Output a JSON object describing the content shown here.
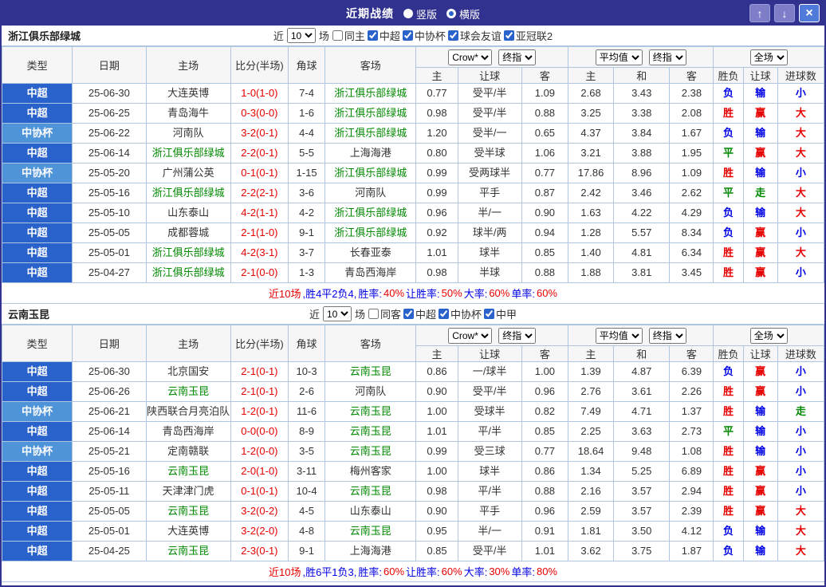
{
  "colors": {
    "accent": "#31318f",
    "grid_border": "#aec6e0",
    "league_bg": {
      "中超": "#2a62cc",
      "中协杯": "#4f94d9"
    },
    "result_text": {
      "胜": "#e60000",
      "平": "#008800",
      "负": "#0000e6",
      "赢": "#e60000",
      "走": "#008800",
      "输": "#0000e6",
      "大": "#e60000",
      "小": "#0000e6"
    },
    "score_color": "#e60000",
    "focus_team_color": "#008800"
  },
  "titlebar": {
    "title": "近期战绩",
    "layout_options": [
      {
        "label": "竖版",
        "checked": false
      },
      {
        "label": "横版",
        "checked": true
      }
    ],
    "buttons": [
      {
        "name": "move-up",
        "glyph": "↑"
      },
      {
        "name": "move-down",
        "glyph": "↓"
      },
      {
        "name": "close",
        "glyph": "×"
      }
    ]
  },
  "table_header": {
    "main_cols": [
      "类型",
      "日期",
      "主场",
      "比分(半场)",
      "角球",
      "客场"
    ],
    "asia_group": {
      "select1": "Crow*",
      "select2": "终指",
      "subcols": [
        "主",
        "让球",
        "客"
      ]
    },
    "europe_group": {
      "select1": "平均值",
      "select2": "终指",
      "subcols": [
        "主",
        "和",
        "客"
      ]
    },
    "result_group": {
      "select": "全场",
      "subcols": [
        "胜负",
        "让球",
        "进球数"
      ]
    }
  },
  "sections": [
    {
      "team": "浙江俱乐部绿城",
      "filter": {
        "near_label": "近",
        "count": "10",
        "match_label": "场",
        "checkboxes": [
          {
            "label": "同主",
            "checked": false
          },
          {
            "label": "中超",
            "checked": true
          },
          {
            "label": "中协杯",
            "checked": true
          },
          {
            "label": "球会友谊",
            "checked": true
          },
          {
            "label": "亚冠联2",
            "checked": true
          }
        ]
      },
      "rows": [
        [
          "中超",
          "25-06-30",
          "大连英博",
          "1-0(1-0)",
          "7-4",
          "浙江俱乐部绿城",
          "0.77",
          "受平/半",
          "1.09",
          "2.68",
          "3.43",
          "2.38",
          "负",
          "输",
          "小"
        ],
        [
          "中超",
          "25-06-25",
          "青岛海牛",
          "0-3(0-0)",
          "1-6",
          "浙江俱乐部绿城",
          "0.98",
          "受平/半",
          "0.88",
          "3.25",
          "3.38",
          "2.08",
          "胜",
          "赢",
          "大"
        ],
        [
          "中协杯",
          "25-06-22",
          "河南队",
          "3-2(0-1)",
          "4-4",
          "浙江俱乐部绿城",
          "1.20",
          "受半/一",
          "0.65",
          "4.37",
          "3.84",
          "1.67",
          "负",
          "输",
          "大"
        ],
        [
          "中超",
          "25-06-14",
          "浙江俱乐部绿城",
          "2-2(0-1)",
          "5-5",
          "上海海港",
          "0.80",
          "受半球",
          "1.06",
          "3.21",
          "3.88",
          "1.95",
          "平",
          "赢",
          "大"
        ],
        [
          "中协杯",
          "25-05-20",
          "广州蒲公英",
          "0-1(0-1)",
          "1-15",
          "浙江俱乐部绿城",
          "0.99",
          "受两球半",
          "0.77",
          "17.86",
          "8.96",
          "1.09",
          "胜",
          "输",
          "小"
        ],
        [
          "中超",
          "25-05-16",
          "浙江俱乐部绿城",
          "2-2(2-1)",
          "3-6",
          "河南队",
          "0.99",
          "平手",
          "0.87",
          "2.42",
          "3.46",
          "2.62",
          "平",
          "走",
          "大"
        ],
        [
          "中超",
          "25-05-10",
          "山东泰山",
          "4-2(1-1)",
          "4-2",
          "浙江俱乐部绿城",
          "0.96",
          "半/一",
          "0.90",
          "1.63",
          "4.22",
          "4.29",
          "负",
          "输",
          "大"
        ],
        [
          "中超",
          "25-05-05",
          "成都蓉城",
          "2-1(1-0)",
          "9-1",
          "浙江俱乐部绿城",
          "0.92",
          "球半/两",
          "0.94",
          "1.28",
          "5.57",
          "8.34",
          "负",
          "赢",
          "小"
        ],
        [
          "中超",
          "25-05-01",
          "浙江俱乐部绿城",
          "4-2(3-1)",
          "3-7",
          "长春亚泰",
          "1.01",
          "球半",
          "0.85",
          "1.40",
          "4.81",
          "6.34",
          "胜",
          "赢",
          "大"
        ],
        [
          "中超",
          "25-04-27",
          "浙江俱乐部绿城",
          "2-1(0-0)",
          "1-3",
          "青岛西海岸",
          "0.98",
          "半球",
          "0.88",
          "1.88",
          "3.81",
          "3.45",
          "胜",
          "赢",
          "小"
        ]
      ],
      "summary": [
        {
          "text": "近10场",
          "color": "#e60000"
        },
        {
          "text": ",胜4平2负4, ",
          "color": "#0000e6"
        },
        {
          "text": "胜率:",
          "color": "#0000e6"
        },
        {
          "text": "40%",
          "color": "#e60000"
        },
        {
          "text": " 让胜率:",
          "color": "#0000e6"
        },
        {
          "text": "50%",
          "color": "#e60000"
        },
        {
          "text": " 大率:",
          "color": "#0000e6"
        },
        {
          "text": "60%",
          "color": "#e60000"
        },
        {
          "text": " 单率:",
          "color": "#0000e6"
        },
        {
          "text": "60%",
          "color": "#e60000"
        }
      ]
    },
    {
      "team": "云南玉昆",
      "filter": {
        "near_label": "近",
        "count": "10",
        "match_label": "场",
        "checkboxes": [
          {
            "label": "同客",
            "checked": false
          },
          {
            "label": "中超",
            "checked": true
          },
          {
            "label": "中协杯",
            "checked": true
          },
          {
            "label": "中甲",
            "checked": true
          }
        ]
      },
      "rows": [
        [
          "中超",
          "25-06-30",
          "北京国安",
          "2-1(0-1)",
          "10-3",
          "云南玉昆",
          "0.86",
          "一/球半",
          "1.00",
          "1.39",
          "4.87",
          "6.39",
          "负",
          "赢",
          "小"
        ],
        [
          "中超",
          "25-06-26",
          "云南玉昆",
          "2-1(0-1)",
          "2-6",
          "河南队",
          "0.90",
          "受平/半",
          "0.96",
          "2.76",
          "3.61",
          "2.26",
          "胜",
          "赢",
          "小"
        ],
        [
          "中协杯",
          "25-06-21",
          "陕西联合月亮泊队",
          "1-2(0-1)",
          "11-6",
          "云南玉昆",
          "1.00",
          "受球半",
          "0.82",
          "7.49",
          "4.71",
          "1.37",
          "胜",
          "输",
          "走"
        ],
        [
          "中超",
          "25-06-14",
          "青岛西海岸",
          "0-0(0-0)",
          "8-9",
          "云南玉昆",
          "1.01",
          "平/半",
          "0.85",
          "2.25",
          "3.63",
          "2.73",
          "平",
          "输",
          "小"
        ],
        [
          "中协杯",
          "25-05-21",
          "定南赣联",
          "1-2(0-0)",
          "3-5",
          "云南玉昆",
          "0.99",
          "受三球",
          "0.77",
          "18.64",
          "9.48",
          "1.08",
          "胜",
          "输",
          "小"
        ],
        [
          "中超",
          "25-05-16",
          "云南玉昆",
          "2-0(1-0)",
          "3-11",
          "梅州客家",
          "1.00",
          "球半",
          "0.86",
          "1.34",
          "5.25",
          "6.89",
          "胜",
          "赢",
          "小"
        ],
        [
          "中超",
          "25-05-11",
          "天津津门虎",
          "0-1(0-1)",
          "10-4",
          "云南玉昆",
          "0.98",
          "平/半",
          "0.88",
          "2.16",
          "3.57",
          "2.94",
          "胜",
          "赢",
          "小"
        ],
        [
          "中超",
          "25-05-05",
          "云南玉昆",
          "3-2(0-2)",
          "4-5",
          "山东泰山",
          "0.90",
          "平手",
          "0.96",
          "2.59",
          "3.57",
          "2.39",
          "胜",
          "赢",
          "大"
        ],
        [
          "中超",
          "25-05-01",
          "大连英博",
          "3-2(2-0)",
          "4-8",
          "云南玉昆",
          "0.95",
          "半/一",
          "0.91",
          "1.81",
          "3.50",
          "4.12",
          "负",
          "输",
          "大"
        ],
        [
          "中超",
          "25-04-25",
          "云南玉昆",
          "2-3(0-1)",
          "9-1",
          "上海海港",
          "0.85",
          "受平/半",
          "1.01",
          "3.62",
          "3.75",
          "1.87",
          "负",
          "输",
          "大"
        ]
      ],
      "summary": [
        {
          "text": "近10场",
          "color": "#e60000"
        },
        {
          "text": ",胜6平1负3, ",
          "color": "#0000e6"
        },
        {
          "text": "胜率:",
          "color": "#0000e6"
        },
        {
          "text": "60%",
          "color": "#e60000"
        },
        {
          "text": " 让胜率:",
          "color": "#0000e6"
        },
        {
          "text": "60%",
          "color": "#e60000"
        },
        {
          "text": " 大率:",
          "color": "#0000e6"
        },
        {
          "text": "30%",
          "color": "#e60000"
        },
        {
          "text": " 单率:",
          "color": "#0000e6"
        },
        {
          "text": "80%",
          "color": "#e60000"
        }
      ]
    }
  ]
}
